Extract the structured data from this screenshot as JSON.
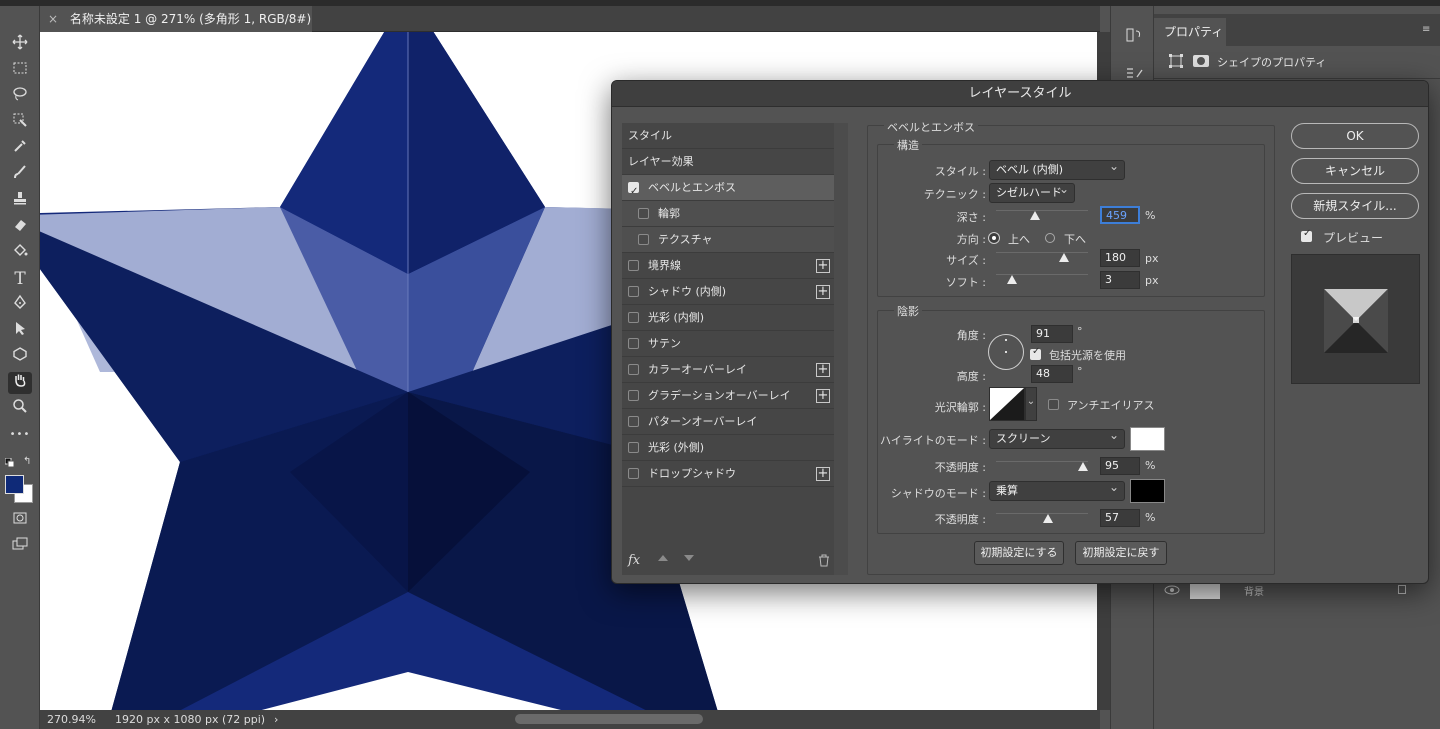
{
  "document": {
    "tab_title": "名称未設定 1 @ 271% (多角形 1, RGB/8#) *",
    "close_glyph": "×",
    "zoom": "270.94%",
    "size_info": "1920 px x 1080 px (72 ppi)",
    "status_arrow": "›"
  },
  "colors": {
    "foreground": "#0f2a78",
    "background": "#ffffff",
    "star_mid": "#14297a",
    "star_dark": "#0b1a4e",
    "star_light": "#aab4d8"
  },
  "toolbar": {
    "tools": [
      "move-icon",
      "marquee-icon",
      "lasso-icon",
      "object-select-icon",
      "eyedropper-icon",
      "brush-icon",
      "stamp-icon",
      "eraser-icon",
      "paint-bucket-icon",
      "type-icon",
      "pen-icon",
      "path-select-icon",
      "shape-icon",
      "hand-icon",
      "zoom-icon",
      "more-icon",
      "quick-mask-icon",
      "screen-mode-icon"
    ],
    "type_glyph": "T",
    "more_glyph": "•••"
  },
  "properties": {
    "tab": "プロパティ",
    "subtitle": "シェイプのプロパティ",
    "layer_name": "背景"
  },
  "dialog": {
    "title": "レイヤースタイル",
    "style_header": "スタイル",
    "layer_effects_header": "レイヤー効果",
    "effects": [
      {
        "label": "ベベルとエンボス",
        "checked": true,
        "selected": true,
        "plus": false,
        "indent": false
      },
      {
        "label": "輪郭",
        "checked": false,
        "selected": false,
        "plus": false,
        "indent": true
      },
      {
        "label": "テクスチャ",
        "checked": false,
        "selected": false,
        "plus": false,
        "indent": true
      },
      {
        "label": "境界線",
        "checked": false,
        "selected": false,
        "plus": true,
        "indent": false
      },
      {
        "label": "シャドウ (内側)",
        "checked": false,
        "selected": false,
        "plus": true,
        "indent": false
      },
      {
        "label": "光彩 (内側)",
        "checked": false,
        "selected": false,
        "plus": false,
        "indent": false
      },
      {
        "label": "サテン",
        "checked": false,
        "selected": false,
        "plus": false,
        "indent": false
      },
      {
        "label": "カラーオーバーレイ",
        "checked": false,
        "selected": false,
        "plus": true,
        "indent": false
      },
      {
        "label": "グラデーションオーバーレイ",
        "checked": false,
        "selected": false,
        "plus": true,
        "indent": false
      },
      {
        "label": "パターンオーバーレイ",
        "checked": false,
        "selected": false,
        "plus": false,
        "indent": false
      },
      {
        "label": "光彩 (外側)",
        "checked": false,
        "selected": false,
        "plus": false,
        "indent": false
      },
      {
        "label": "ドロップシャドウ",
        "checked": false,
        "selected": false,
        "plus": true,
        "indent": false
      }
    ],
    "plus_glyph": "+",
    "fx_label": "fx",
    "section_title": "ベベルとエンボス",
    "structure": {
      "title": "構造",
      "style_label": "スタイル :",
      "style_value": "ベベル (内側)",
      "technique_label": "テクニック :",
      "technique_value": "シゼルハード",
      "depth_label": "深さ :",
      "depth_value": "459",
      "depth_unit": "%",
      "depth_level": 0.42,
      "direction_label": "方向 :",
      "direction_up": "上へ",
      "direction_down": "下へ",
      "size_label": "サイズ :",
      "size_value": "180",
      "size_unit": "px",
      "size_level": 0.74,
      "soften_label": "ソフト :",
      "soften_value": "3",
      "soften_unit": "px",
      "soften_level": 0.17
    },
    "shading": {
      "title": "陰影",
      "angle_label": "角度 :",
      "angle_value": "91",
      "angle_unit": "°",
      "global_light_label": "包括光源を使用",
      "global_light_checked": true,
      "altitude_label": "高度 :",
      "altitude_value": "48",
      "altitude_unit": "°",
      "gloss_label": "光沢輪郭 :",
      "antialias_label": "アンチエイリアス",
      "antialias_checked": false,
      "highlight_mode_label": "ハイライトのモード :",
      "highlight_mode_value": "スクリーン",
      "highlight_color": "#ffffff",
      "highlight_opacity_label": "不透明度 :",
      "highlight_opacity_value": "95",
      "highlight_opacity_unit": "%",
      "highlight_opacity_level": 0.95,
      "shadow_mode_label": "シャドウのモード :",
      "shadow_mode_value": "乗算",
      "shadow_color": "#000000",
      "shadow_opacity_label": "不透明度 :",
      "shadow_opacity_value": "57",
      "shadow_opacity_unit": "%",
      "shadow_opacity_level": 0.57
    },
    "make_default": "初期設定にする",
    "reset_default": "初期設定に戻す",
    "ok": "OK",
    "cancel": "キャンセル",
    "new_style": "新規スタイル...",
    "preview_label": "プレビュー",
    "preview_checked": true
  }
}
